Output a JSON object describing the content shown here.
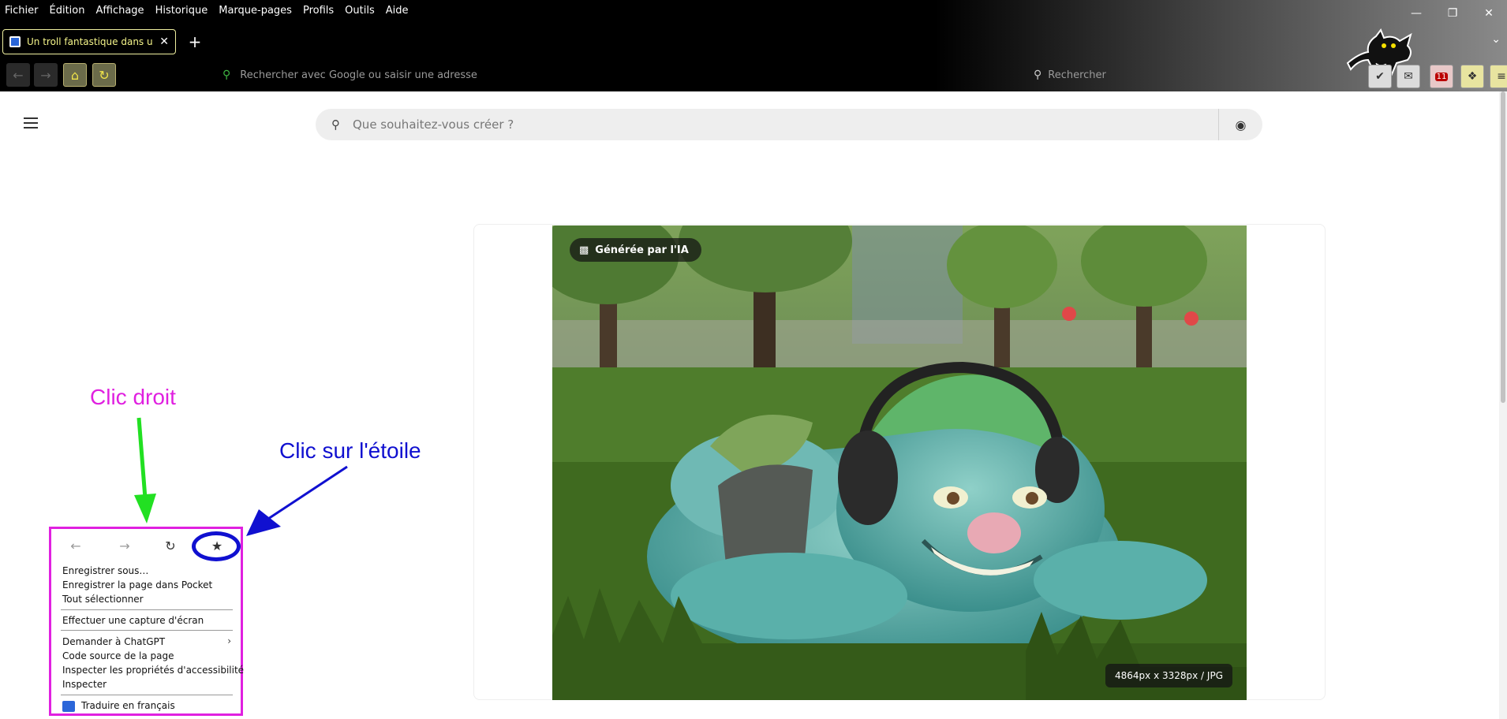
{
  "menubar": {
    "items": [
      "Fichier",
      "Édition",
      "Affichage",
      "Historique",
      "Marque-pages",
      "Profils",
      "Outils",
      "Aide"
    ]
  },
  "window_controls": {
    "minimize": "—",
    "restore": "❐",
    "close": "✕"
  },
  "tab": {
    "title": "Un troll fantastique dans un en",
    "close": "✕",
    "new_tab": "+",
    "list_all": "⌄"
  },
  "nav": {
    "back": "←",
    "forward": "→",
    "home": "⌂",
    "reload": "↻",
    "url_placeholder": "Rechercher avec Google ou saisir une adresse",
    "search_placeholder": "Rechercher"
  },
  "extensions": {
    "badge_count": "11"
  },
  "page": {
    "search_placeholder": "Que souhaitez-vous créer ?",
    "ai_badge": "Générée par l'IA",
    "image_dims": "4864px x 3328px / JPG"
  },
  "context_menu": {
    "items": [
      "Enregistrer sous…",
      "Enregistrer la page dans Pocket",
      "Tout sélectionner",
      "Effectuer une capture d'écran",
      "Demander à ChatGPT",
      "Code source de la page",
      "Inspecter les propriétés d'accessibilité",
      "Inspecter",
      "Traduire en français"
    ]
  },
  "annotations": {
    "right_click": "Clic droit",
    "star_click": "Clic sur l'étoile"
  },
  "colors": {
    "magenta": "#e020e0",
    "blue": "#1010d0",
    "green": "#22e022",
    "tab_text": "#f5f58a"
  },
  "icons": {
    "search": "search-icon",
    "camera": "camera-icon",
    "star": "star-icon",
    "hamburger": "hamburger-icon"
  }
}
